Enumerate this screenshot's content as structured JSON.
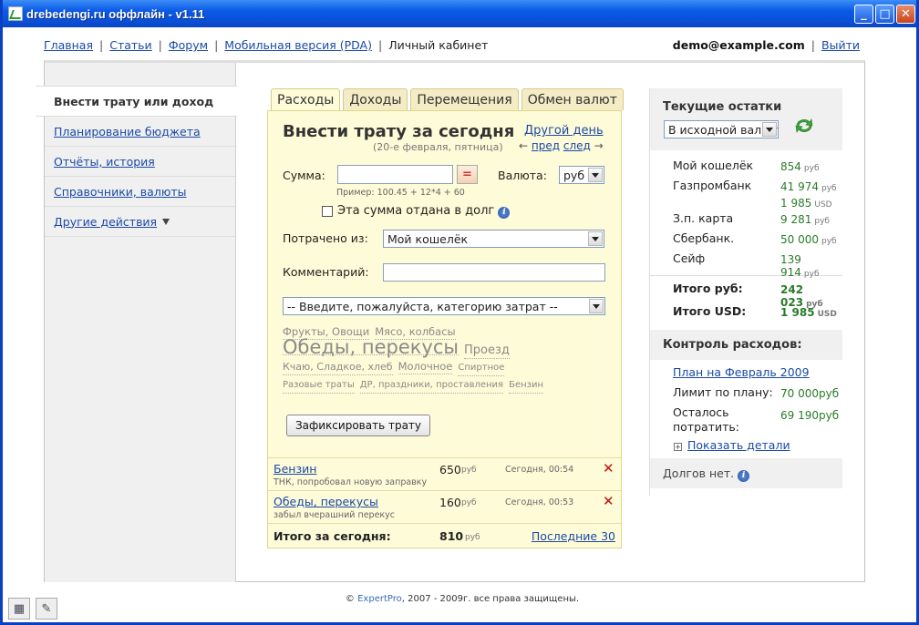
{
  "window": {
    "title": "drebedengi.ru оффлайн - v1.11",
    "btn_min": "_",
    "btn_max": "□",
    "btn_close": "✕"
  },
  "topnav": {
    "links": [
      "Главная",
      "Статьи",
      "Форум",
      "Мобильная версия (PDA)"
    ],
    "current": "Личный кабинет",
    "user_email": "demo@example.com",
    "logout": "Выйти",
    "sep": "|"
  },
  "sidebar": {
    "items": [
      {
        "label": "Внести трату или доход",
        "active": true
      },
      {
        "label": "Планирование бюджета"
      },
      {
        "label": "Отчёты, история"
      },
      {
        "label": "Справочники, валюты"
      },
      {
        "label": "Другие действия"
      }
    ]
  },
  "tabs": [
    "Расходы",
    "Доходы",
    "Перемещения",
    "Обмен валют"
  ],
  "form": {
    "title": "Внести трату за сегодня",
    "date": "(20-е февраля, пятница)",
    "other_day": "Другой день",
    "prev_arrow": "←",
    "prev": "пред",
    "next": "след",
    "next_arrow": "→",
    "amount_label": "Сумма:",
    "amount_value": "",
    "calc": "=",
    "currency_label": "Валюта:",
    "currency_value": "руб",
    "example": "Пример: 100.45 + 12*4 + 60",
    "debt_label": "Эта сумма отдана в долг",
    "spent_from_label": "Потрачено из:",
    "spent_from_value": "Мой кошелёк",
    "comment_label": "Комментарий:",
    "comment_value": "",
    "category_value": "-- Введите, пожалуйста, категорию затрат --",
    "tags": [
      {
        "t": "Фрукты, Овощи",
        "s": 11.5
      },
      {
        "t": "Мясо, колбасы",
        "s": 11.5
      },
      {
        "t": "Обеды, перекусы",
        "s": 21
      },
      {
        "t": "Проезд",
        "s": 13
      },
      {
        "t": "Кчаю, Сладкое, хлеб",
        "s": 11
      },
      {
        "t": "Молочное",
        "s": 11.5
      },
      {
        "t": "Спиртное",
        "s": 10
      },
      {
        "t": "Разовые траты",
        "s": 10
      },
      {
        "t": "ДР, праздники, проставления",
        "s": 10
      },
      {
        "t": "Бензин",
        "s": 10
      }
    ],
    "submit": "Зафиксировать трату"
  },
  "transactions": {
    "rows": [
      {
        "name": "Бензин",
        "note": "ТНК, попробовал новую заправку",
        "amount": "650",
        "currency": "руб",
        "time": "Сегодня, 00:54",
        "del": "✕"
      },
      {
        "name": "Обеды, перекусы",
        "note": "забыл вчерашний перекус",
        "amount": "160",
        "currency": "руб",
        "time": "Сегодня, 00:53",
        "del": "✕"
      }
    ],
    "total_label": "Итого за сегодня:",
    "total_amount": "810",
    "total_currency": "руб",
    "last30": "Последние 30"
  },
  "balances": {
    "title": "Текущие остатки",
    "currency_select": "В исходной валюте",
    "rows": [
      {
        "name": "Мой кошелёк",
        "value": "854",
        "cur": "руб"
      },
      {
        "name": "Газпромбанк",
        "value": "41 974",
        "cur": "руб"
      },
      {
        "name": "",
        "value": "1 985",
        "cur": "USD"
      },
      {
        "name": "З.п. карта",
        "value": "9 281",
        "cur": "руб"
      },
      {
        "name": "Сбербанк.",
        "value": "50 000",
        "cur": "руб"
      },
      {
        "name": "Сейф",
        "value": "139 914",
        "cur": "руб"
      }
    ],
    "total_rub_label": "Итого руб:",
    "total_rub": "242 023",
    "total_rub_cur": "руб",
    "total_usd_label": "Итого USD:",
    "total_usd": "1 985",
    "total_usd_cur": "USD"
  },
  "control": {
    "title": "Контроль расходов:",
    "plan_link": "План на Февраль 2009",
    "limit_label": "Лимит по плану:",
    "limit_value": "70 000",
    "limit_cur": "руб",
    "left_label": "Осталось потратить:",
    "left_value": "69 190",
    "left_cur": "руб",
    "plus": "+",
    "show_details": "Показать детали",
    "no_debts": "Долгов нет."
  },
  "footer": {
    "copy": "©",
    "link": "ExpertPro",
    "text": ", 2007 - 2009г. все права защищены."
  },
  "colors": {
    "titlebar": "#0a5ae6",
    "panel": "#fefbd8",
    "link": "#1a4aa6",
    "positive": "#2a7a2a",
    "delete": "#c01010"
  }
}
